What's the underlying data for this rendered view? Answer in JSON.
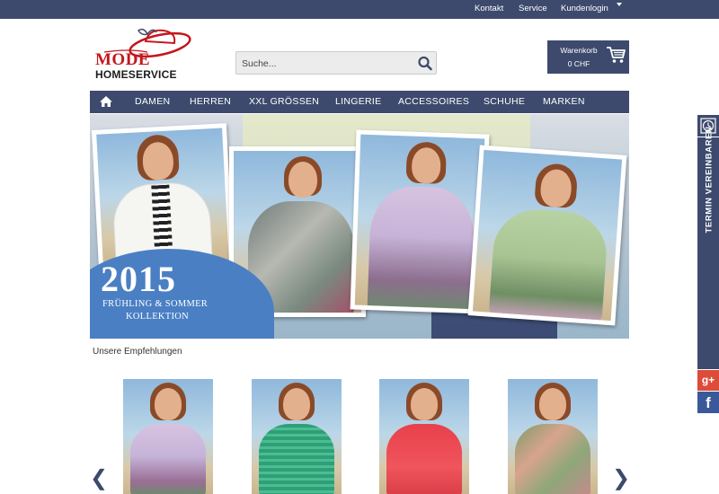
{
  "topbar": {
    "links": [
      "Kontakt",
      "Service",
      "Kundenlogin"
    ]
  },
  "logo": {
    "line1": "MODE",
    "line2": "HOMESERVICE"
  },
  "search": {
    "placeholder": "Suche...",
    "icon": "search-icon"
  },
  "cart": {
    "label": "Warenkorb",
    "amount": "0 CHF",
    "icon": "cart-icon"
  },
  "nav": {
    "home_icon": "home-icon",
    "items": [
      "DAMEN",
      "HERREN",
      "XXL GRÖSSEN",
      "LINGERIE",
      "ACCESSOIRES",
      "SCHUHE",
      "MARKEN"
    ]
  },
  "hero": {
    "year": "2015",
    "line1": "FRÜHLING & SOMMER",
    "line2": "KOLLEKTION"
  },
  "recommendations": {
    "title": "Unsere Empfehlungen",
    "prev": "❮",
    "next": "❯"
  },
  "side": {
    "clock_icon": "clock-icon",
    "termin": "TERMIN VEREINBAREN",
    "gplus": "g+",
    "fb": "f"
  },
  "colors": {
    "brand_navy": "#3d4a6d",
    "logo_red": "#c4161c",
    "hero_badge_blue": "#4a7fc4",
    "gplus_red": "#dd4b39",
    "facebook_blue": "#3b5998"
  }
}
